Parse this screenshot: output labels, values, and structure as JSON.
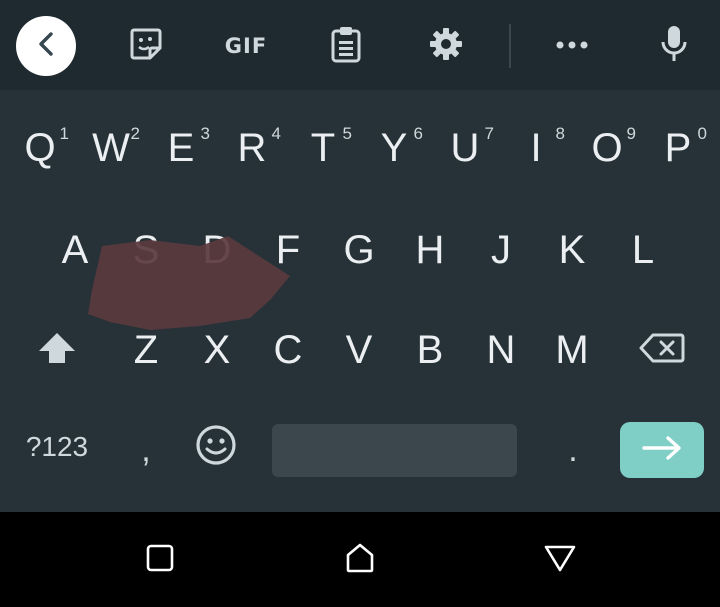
{
  "toolbar": {
    "gif_label": "GIF",
    "icons": [
      "back-arrow",
      "sticker",
      "gif",
      "clipboard",
      "settings",
      "more",
      "microphone"
    ]
  },
  "rows": [
    [
      {
        "label": "Q",
        "hint": "1"
      },
      {
        "label": "W",
        "hint": "2"
      },
      {
        "label": "E",
        "hint": "3"
      },
      {
        "label": "R",
        "hint": "4"
      },
      {
        "label": "T",
        "hint": "5"
      },
      {
        "label": "Y",
        "hint": "6"
      },
      {
        "label": "U",
        "hint": "7"
      },
      {
        "label": "I",
        "hint": "8"
      },
      {
        "label": "O",
        "hint": "9"
      },
      {
        "label": "P",
        "hint": "0"
      }
    ],
    [
      {
        "label": "A"
      },
      {
        "label": "S"
      },
      {
        "label": "D"
      },
      {
        "label": "F"
      },
      {
        "label": "G"
      },
      {
        "label": "H"
      },
      {
        "label": "J"
      },
      {
        "label": "K"
      },
      {
        "label": "L"
      }
    ],
    [
      {
        "label": "Z"
      },
      {
        "label": "X"
      },
      {
        "label": "C"
      },
      {
        "label": "V"
      },
      {
        "label": "B"
      },
      {
        "label": "N"
      },
      {
        "label": "M"
      }
    ]
  ],
  "bottom_row": {
    "symbols_label": "?123",
    "comma_label": ",",
    "period_label": "."
  },
  "colors": {
    "keyboard_bg": "#263238",
    "toolbar_bg": "#1f2a30",
    "enter_key": "#7fcfc6",
    "space_key": "#3b474d",
    "smudge": "#5a3a3e"
  }
}
